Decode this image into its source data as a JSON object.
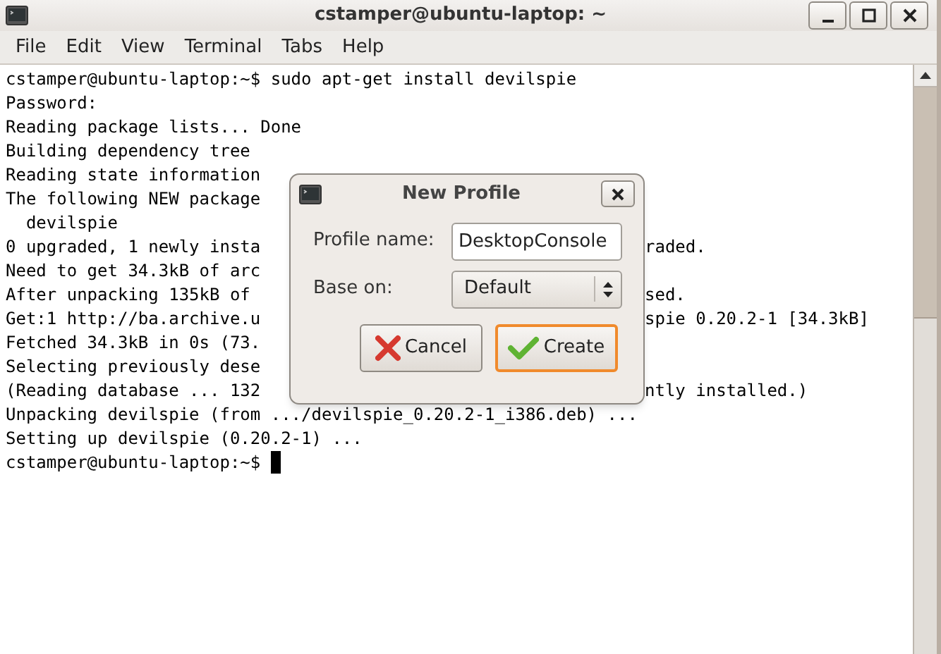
{
  "window": {
    "title": "cstamper@ubuntu-laptop: ~"
  },
  "menu": [
    "File",
    "Edit",
    "View",
    "Terminal",
    "Tabs",
    "Help"
  ],
  "terminal": {
    "cursor": true,
    "lines": [
      {
        "text": "cstamper@ubuntu-laptop:~$ sudo apt-get install devilspie"
      },
      {
        "text": "Password:"
      },
      {
        "text": "Reading package lists... Done"
      },
      {
        "text": "Building dependency tree"
      },
      {
        "text": "Reading state information"
      },
      {
        "text": "The following NEW package"
      },
      {
        "text": "  devilspie"
      },
      {
        "text": "0 upgraded, 1 newly insta",
        "right": "raded."
      },
      {
        "text": "Need to get 34.3kB of arc"
      },
      {
        "text": "After unpacking 135kB of",
        "right": "sed."
      },
      {
        "text": "Get:1 http://ba.archive.u",
        "right": "spie 0.20.2-1 [34.3kB]"
      },
      {
        "text": "Fetched 34.3kB in 0s (73."
      },
      {
        "text": "Selecting previously dese"
      },
      {
        "text": "(Reading database ... 132",
        "right": "ntly installed.)"
      },
      {
        "text": "Unpacking devilspie (from .../devilspie_0.20.2-1_i386.deb) ..."
      },
      {
        "text": "Setting up devilspie (0.20.2-1) ..."
      },
      {
        "text": "cstamper@ubuntu-laptop:~$ "
      }
    ]
  },
  "dialog": {
    "title": "New Profile",
    "fields": [
      {
        "label": "Profile name:",
        "kind": "text",
        "value": "DesktopConsole"
      },
      {
        "label": "Base on:",
        "kind": "combo",
        "value": "Default"
      }
    ],
    "buttons": [
      {
        "label": "Cancel",
        "kind": "cancel",
        "focused": false
      },
      {
        "label": "Create",
        "kind": "confirm",
        "focused": true
      }
    ]
  }
}
